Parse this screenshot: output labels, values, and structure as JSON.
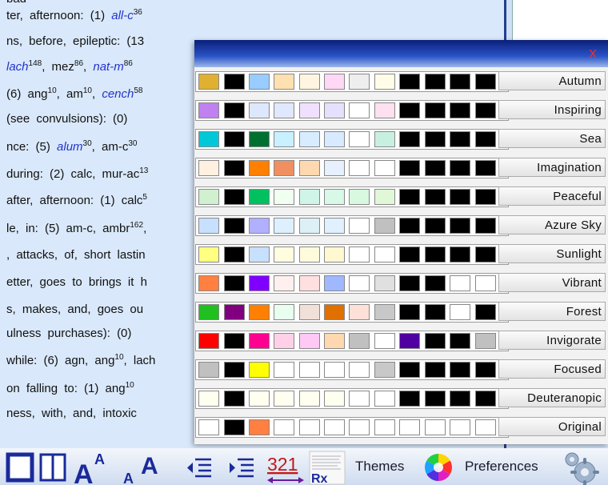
{
  "background_lines": [
    {
      "t": [
        [
          "n",
          "ter, afternoon: (1) "
        ],
        [
          "b",
          "all-c"
        ],
        [
          "s",
          "36"
        ]
      ]
    },
    {
      "t": [
        [
          "n",
          "ns, before, epileptic: (13"
        ]
      ]
    },
    {
      "t": [
        [
          "b",
          "lach"
        ],
        [
          "s",
          "148"
        ],
        [
          "n",
          ", mez"
        ],
        [
          "s",
          "86"
        ],
        [
          "n",
          ", "
        ],
        [
          "b",
          "nat-m"
        ],
        [
          "s",
          "86"
        ]
      ]
    },
    {
      "t": [
        [
          "n",
          "(6) ang"
        ],
        [
          "s",
          "10"
        ],
        [
          "n",
          ", am"
        ],
        [
          "s",
          "10"
        ],
        [
          "n",
          ", "
        ],
        [
          "b",
          "cench"
        ],
        [
          "s",
          "58"
        ]
      ]
    },
    {
      "t": [
        [
          "n",
          "(see convulsions): (0)"
        ]
      ]
    },
    {
      "t": [
        [
          "n",
          "nce: (5) "
        ],
        [
          "b",
          "alum"
        ],
        [
          "s",
          "30"
        ],
        [
          "n",
          ", am-c"
        ],
        [
          "s",
          "30"
        ]
      ]
    },
    {
      "t": [
        [
          "n",
          "during: (2) calc, mur-ac"
        ],
        [
          "s",
          "13"
        ]
      ]
    },
    {
      "t": [
        [
          "n",
          "after, afternoon: (1) calc"
        ],
        [
          "s",
          "5"
        ]
      ]
    },
    {
      "t": [
        [
          "n",
          "le, in: (5) am-c, ambr"
        ],
        [
          "s",
          "162"
        ],
        [
          "n",
          ","
        ]
      ]
    },
    {
      "t": [
        [
          "n",
          ", attacks, of, short lastin"
        ]
      ]
    },
    {
      "t": [
        [
          "n",
          "etter, goes to brings it h"
        ]
      ]
    },
    {
      "t": [
        [
          "n",
          "s, makes, and, goes ou"
        ]
      ]
    },
    {
      "t": [
        [
          "n",
          "ulness purchases): (0)"
        ]
      ]
    },
    {
      "t": [
        [
          "n",
          "while: (6) agn, ang"
        ],
        [
          "s",
          "10"
        ],
        [
          "n",
          ", lach"
        ]
      ]
    },
    {
      "t": [
        [
          "n",
          "on falling to: (1) ang"
        ],
        [
          "s",
          "10"
        ]
      ]
    },
    {
      "t": [
        [
          "n",
          "ness, with, and, intoxic"
        ]
      ]
    },
    {
      "t": [
        [
          "n",
          "bad"
        ]
      ]
    }
  ],
  "dialog": {
    "close_label": "X",
    "themes": [
      {
        "name": "Autumn",
        "colors": [
          "#e0b030",
          "#000000",
          "#99ccff",
          "#ffe0b0",
          "#fff5e0",
          "#ffd8f5",
          "#eeeeee",
          "#fffde8",
          "#000000",
          "#000000",
          "#000000",
          "#000000"
        ]
      },
      {
        "name": "Inspiring",
        "colors": [
          "#c080f0",
          "#000000",
          "#dde8ff",
          "#e0e8ff",
          "#f0e0ff",
          "#e6e0ff",
          "#ffffff",
          "#ffe0f0",
          "#000000",
          "#000000",
          "#000000",
          "#000000"
        ]
      },
      {
        "name": "Sea",
        "colors": [
          "#00c8d8",
          "#000000",
          "#007030",
          "#c8f0ff",
          "#d8ecff",
          "#d8eaff",
          "#ffffff",
          "#c8f0e0",
          "#000000",
          "#000000",
          "#000000",
          "#000000"
        ]
      },
      {
        "name": "Imagination",
        "colors": [
          "#fff0e0",
          "#000000",
          "#ff8000",
          "#f09060",
          "#ffd8b0",
          "#e6f0ff",
          "#ffffff",
          "#ffffff",
          "#000000",
          "#000000",
          "#000000",
          "#000000"
        ]
      },
      {
        "name": "Peaceful",
        "colors": [
          "#d0f0d0",
          "#000000",
          "#00c060",
          "#f0fff0",
          "#d0f5e8",
          "#d8f8e8",
          "#d8f8e0",
          "#e0f8d8",
          "#000000",
          "#000000",
          "#000000",
          "#000000"
        ]
      },
      {
        "name": "Azure Sky",
        "colors": [
          "#c8e0ff",
          "#000000",
          "#b0b0ff",
          "#ddf0ff",
          "#ddf0f5",
          "#e0f0ff",
          "#ffffff",
          "#c0c0c0",
          "#000000",
          "#000000",
          "#000000",
          "#000000"
        ]
      },
      {
        "name": "Sunlight",
        "colors": [
          "#ffff80",
          "#000000",
          "#c8e0ff",
          "#fffde0",
          "#fffadc",
          "#fff8d0",
          "#ffffff",
          "#ffffff",
          "#000000",
          "#000000",
          "#000000",
          "#000000"
        ]
      },
      {
        "name": "Vibrant",
        "colors": [
          "#ff8040",
          "#000000",
          "#8000ff",
          "#fff0f0",
          "#ffe0e0",
          "#a0b8ff",
          "#ffffff",
          "#e0e0e0",
          "#000000",
          "#000000",
          "#ffffff",
          "#ffffff"
        ]
      },
      {
        "name": "Forest",
        "colors": [
          "#20c020",
          "#800080",
          "#ff8000",
          "#e8fff0",
          "#f0e0d8",
          "#e07000",
          "#ffe0d8",
          "#c8c8c8",
          "#000000",
          "#000000",
          "#ffffff",
          "#000000"
        ]
      },
      {
        "name": "Invigorate",
        "colors": [
          "#ff0000",
          "#000000",
          "#ff0090",
          "#ffd0e8",
          "#ffc8f5",
          "#ffd8b0",
          "#c0c0c0",
          "#ffffff",
          "#5000a0",
          "#000000",
          "#000000",
          "#c0c0c0"
        ]
      },
      {
        "name": "Focused",
        "colors": [
          "#c0c0c0",
          "#000000",
          "#ffff00",
          "#ffffff",
          "#ffffff",
          "#ffffff",
          "#ffffff",
          "#c8c8c8",
          "#000000",
          "#000000",
          "#000000",
          "#000000"
        ]
      },
      {
        "name": "Deuteranopic",
        "colors": [
          "#fffff0",
          "#000000",
          "#fffff0",
          "#fffff0",
          "#fffff0",
          "#fffff0",
          "#ffffff",
          "#ffffff",
          "#000000",
          "#000000",
          "#000000",
          "#000000"
        ]
      },
      {
        "name": "Original",
        "colors": [
          "#ffffff",
          "#000000",
          "#ff8040",
          "#ffffff",
          "#ffffff",
          "#ffffff",
          "#ffffff",
          "#ffffff",
          "#ffffff",
          "#ffffff",
          "#ffffff",
          "#ffffff"
        ]
      }
    ]
  },
  "toolbar": {
    "font_a": "A",
    "numbers_icon_text": "321",
    "rx_text": "Rx",
    "themes_label": "Themes",
    "preferences_label": "Preferences"
  }
}
